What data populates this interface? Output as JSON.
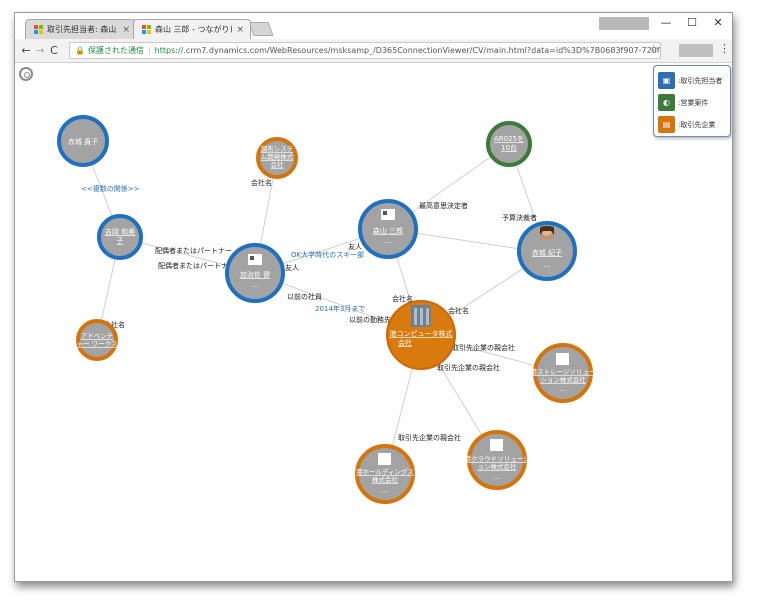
{
  "browser": {
    "tabs": [
      {
        "label": "取引先担当者: 森山 三郎",
        "close": "×",
        "active": false
      },
      {
        "label": "森山 三郎 - つながりビュー",
        "close": "×",
        "active": true
      }
    ],
    "window_controls": {
      "minimize": "—",
      "maximize": "☐",
      "close": "✕"
    },
    "nav": {
      "back": "←",
      "forward": "→",
      "reload": "C"
    },
    "address": {
      "secure_label": "保護された通信",
      "scheme": "https://",
      "url_rest": ".crm7.dynamics.com/WebResources/msksamp_/D365ConnectionViewer/CV/main.html?data=id%3D%7B0683f907-720f-...",
      "star": "☆"
    },
    "menu": "⋮"
  },
  "legend": {
    "items": [
      {
        "label": "取引先担当者",
        "color": "#2f6db5",
        "icon": "contact-card-icon"
      },
      {
        "label": "営業案件",
        "color": "#3c7a3a",
        "icon": "opportunity-icon"
      },
      {
        "label": "取引先企業",
        "color": "#d4740b",
        "icon": "account-building-icon"
      }
    ]
  },
  "colors": {
    "contact_ring": "#1f70c1",
    "opportunity_ring": "#3c7a3a",
    "account_ring": "#d4740b",
    "node_fill": "#a3a3a3",
    "edge": "#cfcfcf",
    "edge_label_link": "#2a6ebb"
  },
  "graph": {
    "nodes": [
      {
        "id": "akagi-takako",
        "label": "赤城 貴子",
        "kind": "contact"
      },
      {
        "id": "yoshioka",
        "label": "吉岡 和美子",
        "kind": "contact"
      },
      {
        "id": "kato",
        "label": "加治佐 健",
        "kind": "contact"
      },
      {
        "id": "moriyama",
        "label": "森山 三郎",
        "kind": "contact"
      },
      {
        "id": "akagi-noriko",
        "label": "赤城 紀子",
        "kind": "contact"
      },
      {
        "id": "chofu-system",
        "label": "調布システム開発株式会社",
        "kind": "account"
      },
      {
        "id": "adventure",
        "label": "アドベンチャー ワークス",
        "kind": "account"
      },
      {
        "id": "minato-computer",
        "label": "港コンピュータ株式会社",
        "kind": "account"
      },
      {
        "id": "minato-storage",
        "label": "港ストレージソリューション株式会社",
        "kind": "account"
      },
      {
        "id": "minato-holdings",
        "label": "港ホールディングス株式会社",
        "kind": "account"
      },
      {
        "id": "minato-cloud",
        "label": "港クラウドソリューション株式会社",
        "kind": "account"
      },
      {
        "id": "ar025",
        "label": "AR025を 10台",
        "kind": "opportunity"
      }
    ],
    "edge_labels": {
      "multiple_relations": "<<複数の関係>>",
      "spouse_1": "配偶者またはパートナー",
      "spouse_2": "配偶者またはパートナー",
      "company_name_1": "会社名",
      "company_name_2": "会社名",
      "company_name_3": "会社名",
      "company_name_4": "会社名",
      "ok_university": "OK大学時代のスキー部",
      "friend_1": "友人",
      "friend_2": "友人",
      "former_employee": "以前の社員",
      "until_2014": "2014年3月まで",
      "former_employer": "以前の勤務先",
      "top_decision_maker": "最高意思決定者",
      "budget_decision": "予算決裁者",
      "parent_1": "取引先企業の親会社",
      "parent_2": "取引先企業の親会社",
      "parent_3": "取引先企業の親会社"
    }
  }
}
